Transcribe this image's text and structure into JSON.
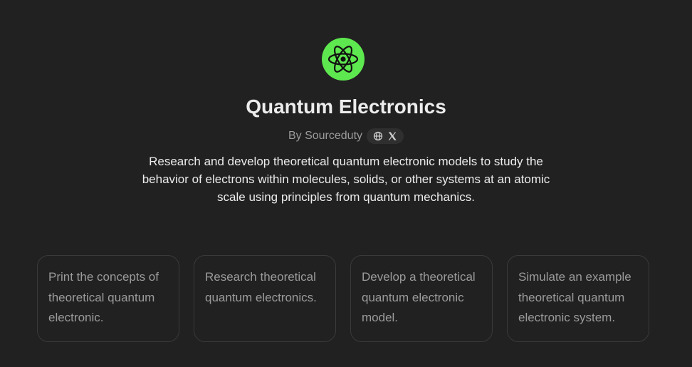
{
  "gpt": {
    "icon": "atom-icon",
    "accent_color": "#5ee84f",
    "name": "Quantum Electronics",
    "byline": "By Sourceduty",
    "social_icons": [
      "globe-icon",
      "x-logo-icon"
    ],
    "description": "Research and develop theoretical quantum electronic models to study the behavior of electrons within molecules, solids, or other systems at an atomic scale using principles from quantum mechanics."
  },
  "starters": [
    {
      "label": "Print the concepts of theoretical quantum electronic."
    },
    {
      "label": "Research theoretical quantum electronics."
    },
    {
      "label": "Develop a theoretical quantum electronic model."
    },
    {
      "label": "Simulate an example theoretical quantum electronic system."
    }
  ]
}
